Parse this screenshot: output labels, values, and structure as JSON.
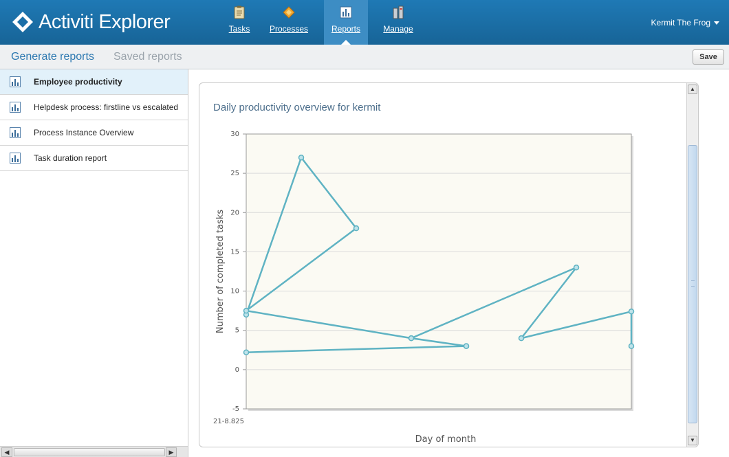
{
  "app": {
    "title": "Activiti Explorer",
    "nav": [
      {
        "label": "Tasks",
        "icon": "clipboard-icon",
        "active": false
      },
      {
        "label": "Processes",
        "icon": "diamond-process-icon",
        "active": false
      },
      {
        "label": "Reports",
        "icon": "bar-chart-icon",
        "active": true
      },
      {
        "label": "Manage",
        "icon": "server-icon",
        "active": false
      }
    ],
    "user": "Kermit The Frog"
  },
  "toolbar": {
    "tabs": [
      "Generate reports",
      "Saved reports"
    ],
    "save_label": "Save"
  },
  "sidebar": {
    "items": [
      {
        "label": "Employee productivity",
        "icon": "report-chart-icon",
        "selected": true
      },
      {
        "label": "Helpdesk process: firstline vs escalated",
        "icon": "report-chart-icon",
        "selected": false
      },
      {
        "label": "Process Instance Overview",
        "icon": "report-chart-icon",
        "selected": false
      },
      {
        "label": "Task duration report",
        "icon": "report-chart-icon",
        "selected": false
      }
    ]
  },
  "chart_data": {
    "type": "line",
    "title": "Daily productivity overview for kermit",
    "xlabel": "Day of month",
    "ylabel": "Number of completed tasks",
    "x_tick_label": "21-8.825",
    "ylim": [
      -5,
      30
    ],
    "yticks": [
      -5,
      0,
      5,
      10,
      15,
      20,
      25,
      30
    ],
    "grid": true,
    "series": [
      {
        "color": "#5fb3c3",
        "points": [
          {
            "x": 0,
            "y": 7
          },
          {
            "x": 1,
            "y": 27
          },
          {
            "x": 2,
            "y": 18
          },
          {
            "x": 0,
            "y": 7.5
          },
          {
            "x": 3,
            "y": 4
          },
          {
            "x": 4,
            "y": 3
          },
          {
            "x": 0,
            "y": 2.2
          },
          {
            "x": 4,
            "y": 3
          },
          {
            "x": 3,
            "y": 4
          },
          {
            "x": 6,
            "y": 13
          },
          {
            "x": 5,
            "y": 4
          },
          {
            "x": 7,
            "y": 7.4
          },
          {
            "x": 7,
            "y": 3
          }
        ]
      }
    ],
    "x_range": [
      0,
      7
    ]
  }
}
